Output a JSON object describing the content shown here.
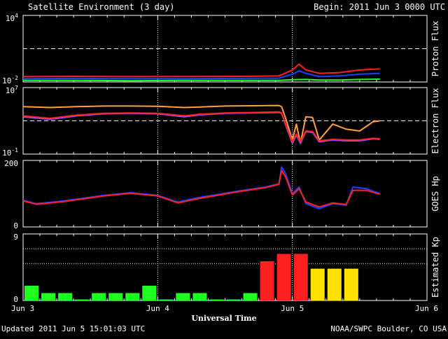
{
  "header": {
    "title": "Satellite Environment (3 day)",
    "begin": "Begin:  2011 Jun 3 0000 UTC"
  },
  "footer": {
    "updated": "Updated 2011 Jun  5 15:01:03 UTC",
    "credit": "NOAA/SWPC Boulder, CO USA",
    "xlabel": "Universal Time"
  },
  "colors": {
    "background": "#000000",
    "frame": "#ffffff",
    "red": "#ff2020",
    "blue": "#2040ff",
    "green": "#20ff20",
    "orange": "#ffa040",
    "purple": "#a050ff",
    "yellow": "#ffe000"
  },
  "chart_data": [
    {
      "type": "line",
      "panel": "proton",
      "ylabel": "Proton Flux",
      "yscale": "log",
      "ylim": [
        0.01,
        10000
      ],
      "yticks": [
        {
          "value": 0.01,
          "base": "10",
          "exp": "-2"
        },
        {
          "value": 10000,
          "base": "10",
          "exp": "4"
        }
      ],
      "threshold": 10,
      "x_unit": "days since 2011 Jun 3 0000 UTC",
      "series": [
        {
          "color": "#ff2020",
          "x": [
            0,
            0.4,
            0.8,
            1.2,
            1.6,
            1.9,
            2.0,
            2.05,
            2.1,
            2.2,
            2.35,
            2.5,
            2.65
          ],
          "y": [
            0.03,
            0.032,
            0.03,
            0.031,
            0.032,
            0.035,
            0.12,
            0.4,
            0.12,
            0.06,
            0.07,
            0.12,
            0.15
          ]
        },
        {
          "color": "#2040ff",
          "x": [
            0,
            0.4,
            0.8,
            1.2,
            1.6,
            1.9,
            2.0,
            2.05,
            2.1,
            2.2,
            2.35,
            2.5,
            2.65
          ],
          "y": [
            0.02,
            0.021,
            0.02,
            0.02,
            0.021,
            0.022,
            0.05,
            0.1,
            0.06,
            0.03,
            0.035,
            0.05,
            0.06
          ]
        },
        {
          "color": "#20ff20",
          "x": [
            0,
            0.4,
            0.8,
            1.2,
            1.6,
            1.9,
            2.0,
            2.1,
            2.2,
            2.35,
            2.5,
            2.65
          ],
          "y": [
            0.014,
            0.014,
            0.013,
            0.014,
            0.014,
            0.014,
            0.016,
            0.017,
            0.015,
            0.015,
            0.017,
            0.018
          ]
        }
      ]
    },
    {
      "type": "line",
      "panel": "electron",
      "ylabel": "Electron Flux",
      "yscale": "log",
      "ylim": [
        0.1,
        10000000
      ],
      "yticks": [
        {
          "value": 0.1,
          "base": "10",
          "exp": "-1"
        },
        {
          "value": 10000000,
          "base": "10",
          "exp": "7"
        }
      ],
      "threshold": 1000,
      "series": [
        {
          "color": "#ffa040",
          "x": [
            0,
            0.2,
            0.4,
            0.6,
            0.8,
            1.0,
            1.2,
            1.3,
            1.5,
            1.7,
            1.9,
            1.92,
            1.95,
            2.0,
            2.03,
            2.06,
            2.1,
            2.15,
            2.2,
            2.3,
            2.4,
            2.5,
            2.6,
            2.65
          ],
          "y": [
            50000,
            40000,
            50000,
            60000,
            60000,
            55000,
            40000,
            45000,
            60000,
            65000,
            70000,
            50000,
            2000,
            5,
            400,
            2,
            3000,
            2500,
            5,
            400,
            100,
            60,
            800,
            1000
          ]
        },
        {
          "color": "#a050ff",
          "x": [
            0,
            0.2,
            0.4,
            0.6,
            0.8,
            1.0,
            1.2,
            1.3,
            1.5,
            1.7,
            1.9,
            1.92,
            1.95,
            2.0,
            2.03,
            2.06,
            2.1,
            2.15,
            2.2,
            2.3,
            2.4,
            2.5,
            2.6,
            2.65
          ],
          "y": [
            3000,
            1500,
            4000,
            7000,
            8000,
            7000,
            3000,
            5000,
            8000,
            9000,
            10000,
            8000,
            300,
            2,
            20,
            2,
            50,
            40,
            3,
            5,
            4,
            4,
            7,
            6
          ]
        },
        {
          "color": "#ff2020",
          "x": [
            0,
            0.2,
            0.4,
            0.6,
            0.8,
            1.0,
            1.2,
            1.3,
            1.5,
            1.7,
            1.9,
            1.92,
            1.95,
            2.0,
            2.03,
            2.06,
            2.1,
            2.15,
            2.2,
            2.3,
            2.4,
            2.5,
            2.6,
            2.65
          ],
          "y": [
            4000,
            2000,
            5000,
            8000,
            9000,
            8000,
            4000,
            6000,
            9000,
            10000,
            12000,
            9000,
            400,
            3,
            25,
            3,
            60,
            50,
            4,
            6,
            5,
            5,
            8,
            7
          ]
        }
      ]
    },
    {
      "type": "line",
      "panel": "hp",
      "ylabel": "GOES Hp",
      "ylim": [
        0,
        200
      ],
      "yticks": [
        0,
        200
      ],
      "series": [
        {
          "color": "#2040ff",
          "x": [
            0,
            0.1,
            0.3,
            0.6,
            0.8,
            1.0,
            1.15,
            1.3,
            1.6,
            1.8,
            1.9,
            1.92,
            1.95,
            2.0,
            2.05,
            2.1,
            2.2,
            2.3,
            2.4,
            2.45,
            2.55,
            2.65
          ],
          "y": [
            80,
            70,
            78,
            95,
            103,
            95,
            75,
            88,
            108,
            120,
            130,
            180,
            160,
            100,
            120,
            70,
            55,
            70,
            65,
            120,
            115,
            100
          ]
        },
        {
          "color": "#ff2020",
          "x": [
            0,
            0.1,
            0.3,
            0.6,
            0.8,
            1.0,
            1.15,
            1.3,
            1.6,
            1.8,
            1.9,
            1.92,
            1.95,
            2.0,
            2.05,
            2.1,
            2.2,
            2.3,
            2.4,
            2.45,
            2.55,
            2.65
          ],
          "y": [
            78,
            68,
            76,
            93,
            101,
            93,
            72,
            85,
            106,
            118,
            128,
            170,
            150,
            96,
            115,
            75,
            60,
            72,
            68,
            110,
            110,
            98
          ]
        }
      ]
    },
    {
      "type": "bar",
      "panel": "kp",
      "ylabel": "Estimated Kp",
      "ylim": [
        0,
        9
      ],
      "yticks": [
        0,
        9
      ],
      "bar_width_days": 0.125,
      "bars": [
        {
          "start": 0.0,
          "value": 2,
          "color": "#20ff20"
        },
        {
          "start": 0.125,
          "value": 1,
          "color": "#20ff20"
        },
        {
          "start": 0.25,
          "value": 1,
          "color": "#20ff20"
        },
        {
          "start": 0.375,
          "value": 0,
          "color": "#20ff20"
        },
        {
          "start": 0.5,
          "value": 1,
          "color": "#20ff20"
        },
        {
          "start": 0.625,
          "value": 1,
          "color": "#20ff20"
        },
        {
          "start": 0.75,
          "value": 1,
          "color": "#20ff20"
        },
        {
          "start": 0.875,
          "value": 2,
          "color": "#20ff20"
        },
        {
          "start": 1.0,
          "value": 0,
          "color": "#20ff20"
        },
        {
          "start": 1.125,
          "value": 1,
          "color": "#20ff20"
        },
        {
          "start": 1.25,
          "value": 1,
          "color": "#20ff20"
        },
        {
          "start": 1.375,
          "value": 0,
          "color": "#20ff20"
        },
        {
          "start": 1.5,
          "value": 0,
          "color": "#20ff20"
        },
        {
          "start": 1.625,
          "value": 1,
          "color": "#20ff20"
        },
        {
          "start": 1.75,
          "value": 5.3,
          "color": "#ff2020"
        },
        {
          "start": 1.875,
          "value": 6.3,
          "color": "#ff2020"
        },
        {
          "start": 2.0,
          "value": 6.3,
          "color": "#ff2020"
        },
        {
          "start": 2.125,
          "value": 4.3,
          "color": "#ffe000"
        },
        {
          "start": 2.25,
          "value": 4.3,
          "color": "#ffe000"
        },
        {
          "start": 2.375,
          "value": 4.3,
          "color": "#ffe000"
        }
      ],
      "reference_lines": [
        5,
        7
      ]
    }
  ],
  "xaxis": {
    "range": [
      0,
      3
    ],
    "ticks": [
      {
        "value": 0,
        "label": "Jun 3"
      },
      {
        "value": 1,
        "label": "Jun 4"
      },
      {
        "value": 2,
        "label": "Jun 5"
      },
      {
        "value": 3,
        "label": "Jun 6"
      }
    ]
  }
}
